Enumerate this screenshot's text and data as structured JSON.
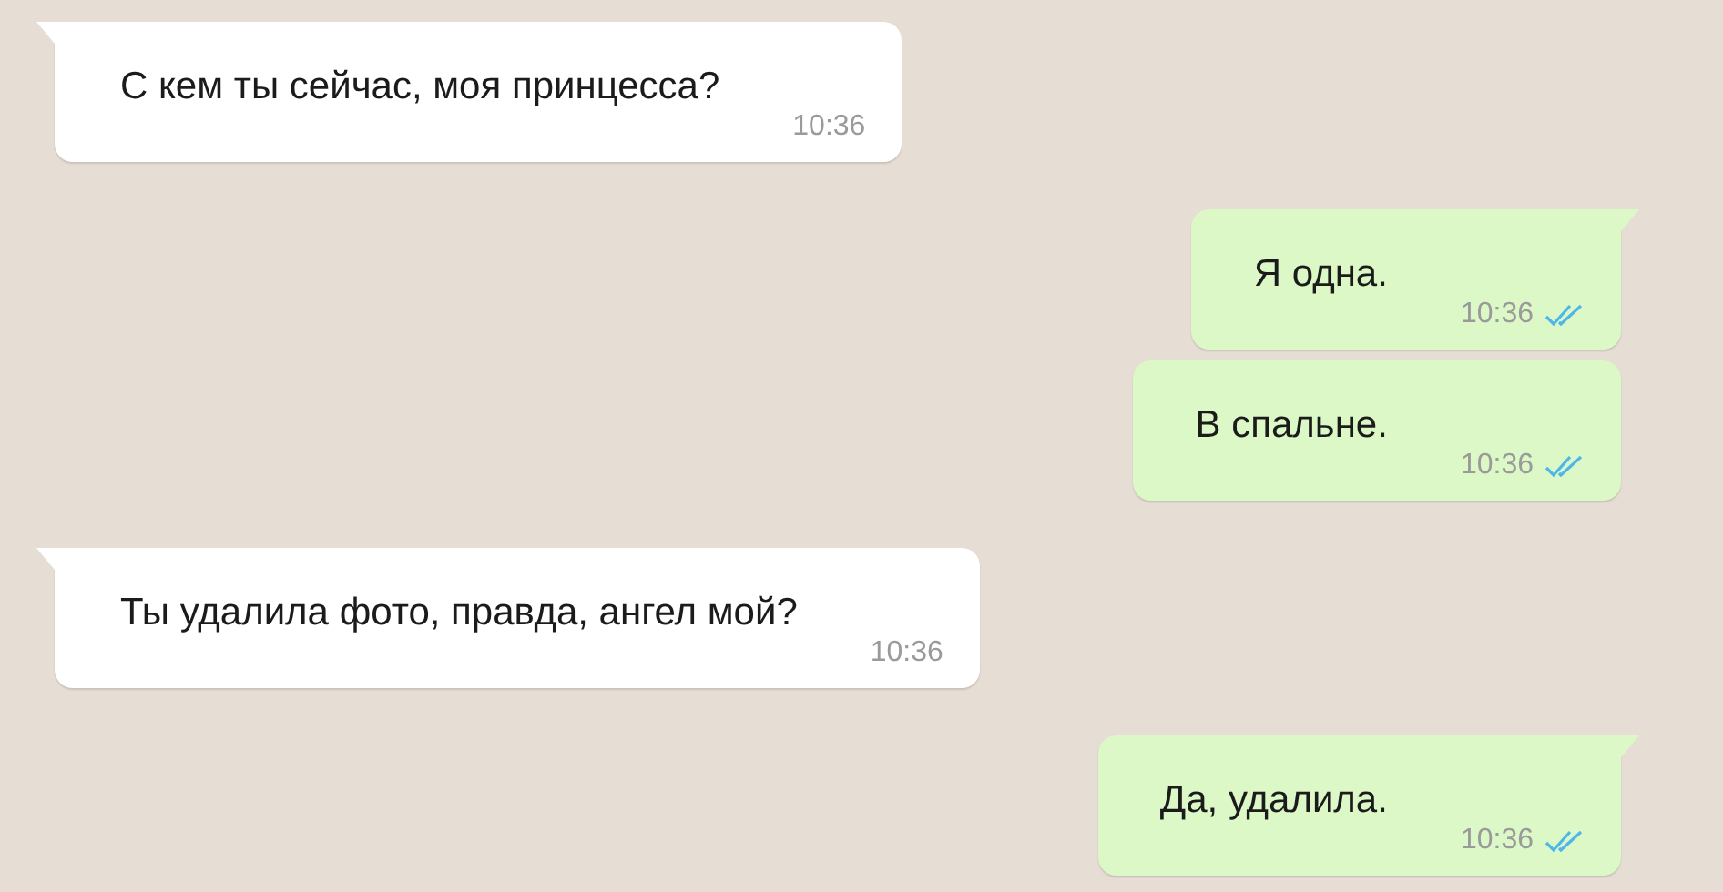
{
  "messages": [
    {
      "kind": "incoming",
      "text": "С кем ты сейчас, моя принцесса?",
      "time": "10:36"
    },
    {
      "kind": "outgoing",
      "text": "Я одна.",
      "time": "10:36",
      "read": true
    },
    {
      "kind": "outgoing",
      "text": "В спальне.",
      "time": "10:36",
      "read": true
    },
    {
      "kind": "incoming",
      "text": "Ты удалила фото, правда, ангел мой?",
      "time": "10:36"
    },
    {
      "kind": "outgoing",
      "text": "Да, удалила.",
      "time": "10:36",
      "read": true
    }
  ]
}
